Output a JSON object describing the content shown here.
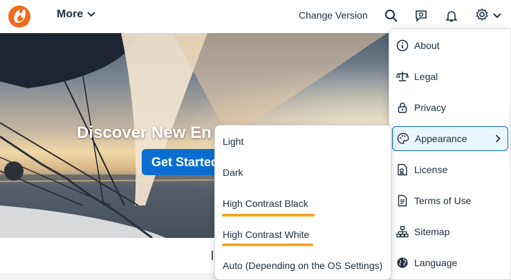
{
  "header": {
    "more_label": "More",
    "change_version_label": "Change Version",
    "icons": [
      "logo-icon",
      "chevron-down-icon",
      "search-icon",
      "feedback-icon",
      "bell-icon",
      "gear-icon"
    ]
  },
  "hero": {
    "title": "Discover New En",
    "cta_label": "Get Started"
  },
  "below": {
    "partial_text": "l"
  },
  "settings_menu": {
    "items": [
      {
        "label": "About",
        "icon": "info-icon"
      },
      {
        "label": "Legal",
        "icon": "scale-icon"
      },
      {
        "label": "Privacy",
        "icon": "lock-icon"
      },
      {
        "label": "Appearance",
        "icon": "palette-icon",
        "active": true,
        "has_submenu": true
      },
      {
        "label": "License",
        "icon": "license-icon"
      },
      {
        "label": "Terms of Use",
        "icon": "document-icon"
      },
      {
        "label": "Sitemap",
        "icon": "sitemap-icon"
      },
      {
        "label": "Language",
        "icon": "globe-icon"
      }
    ]
  },
  "appearance_submenu": {
    "items": [
      {
        "label": "Light"
      },
      {
        "label": "Dark"
      },
      {
        "label": "High Contrast Black",
        "highlighted": true
      },
      {
        "label": "High Contrast White",
        "highlighted": true
      },
      {
        "label": "Auto (Depending on the OS Settings)"
      }
    ],
    "highlight_color": "#f5a623"
  },
  "colors": {
    "accent": "#0a6ed1",
    "active_border": "#0064d9",
    "active_bg": "#ebf5fe",
    "text": "#1d2d3e",
    "logo": "#f06a1d"
  }
}
